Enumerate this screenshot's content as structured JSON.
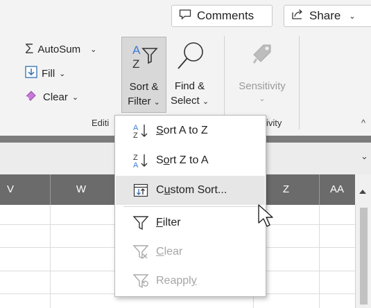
{
  "topbar": {
    "comments_label": "Comments",
    "share_label": "Share"
  },
  "editing_group": {
    "autosum_label": "AutoSum",
    "fill_label": "Fill",
    "clear_label": "Clear",
    "sort_filter_label_line1": "Sort &",
    "sort_filter_label_line2": "Filter",
    "find_select_label_line1": "Find &",
    "find_select_label_line2": "Select",
    "group_label": "Editi"
  },
  "sensitivity_group": {
    "sensitivity_label": "Sensitivity",
    "group_label": "ivity"
  },
  "columns": [
    "V",
    "W",
    "Z",
    "AA"
  ],
  "sort_menu": {
    "items": [
      {
        "pre": "",
        "accel": "S",
        "post": "ort A to Z",
        "icon": "sort-a-to-z-icon",
        "state": "normal"
      },
      {
        "pre": "S",
        "accel": "o",
        "post": "rt Z to A",
        "icon": "sort-z-to-a-icon",
        "state": "normal"
      },
      {
        "pre": "C",
        "accel": "u",
        "post": "stom Sort...",
        "icon": "custom-sort-icon",
        "state": "hover"
      },
      {
        "pre": "",
        "accel": "F",
        "post": "ilter",
        "icon": "filter-icon",
        "state": "normal"
      },
      {
        "pre": "",
        "accel": "C",
        "post": "lear",
        "icon": "clear-filter-icon",
        "state": "disabled"
      },
      {
        "pre": "Reappl",
        "accel": "y",
        "post": "",
        "icon": "reapply-filter-icon",
        "state": "disabled"
      }
    ]
  }
}
